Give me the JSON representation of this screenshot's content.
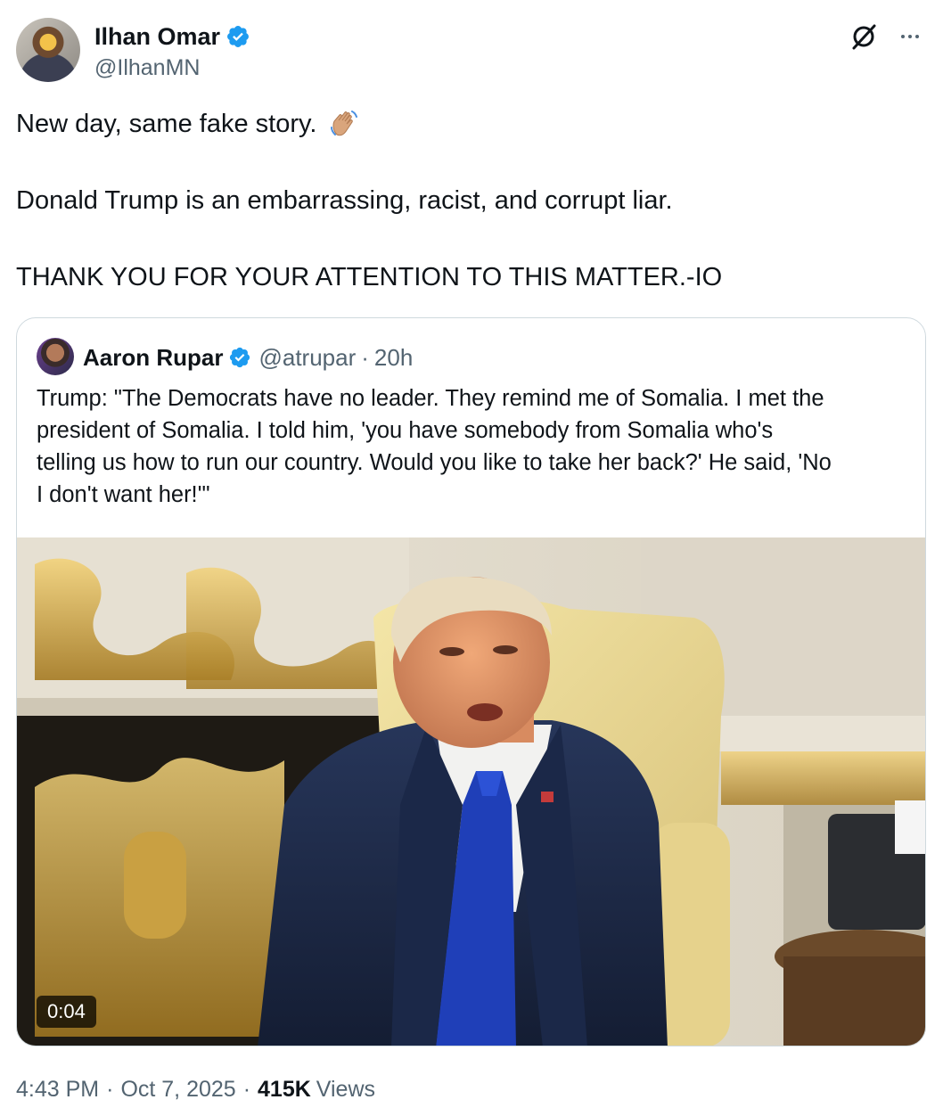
{
  "author": {
    "display_name": "Ilhan Omar",
    "handle": "@IlhanMN",
    "verified_icon": "verified-badge-icon"
  },
  "tweet": {
    "line1": "New day, same fake story.",
    "line1_emoji": "waving-hand-icon",
    "line2": "Donald Trump is an embarrassing, racist, and corrupt liar.",
    "line3": "THANK YOU FOR YOUR ATTENTION TO THIS MATTER.-IO"
  },
  "quote": {
    "display_name": "Aaron Rupar",
    "handle": "@atrupar",
    "separator": "·",
    "time": "20h",
    "text_lines": [
      "Trump: \"The Democrats have no leader. They remind me of Somalia. I met the",
      "president of Somalia. I told him, 'you have somebody from Somalia who's",
      "telling us how to run our country. Would you like to take her back?' He said, 'No",
      "I don't want her!'\""
    ],
    "video_duration": "0:04"
  },
  "footer": {
    "time": "4:43 PM",
    "sep1": "·",
    "date": "Oct 7, 2025",
    "sep2": "·",
    "views_count": "415K",
    "views_label": "Views"
  },
  "colors": {
    "text": "#0f1419",
    "muted": "#536471",
    "verified_blue": "#1d9bf0",
    "border": "#cfd9de"
  }
}
